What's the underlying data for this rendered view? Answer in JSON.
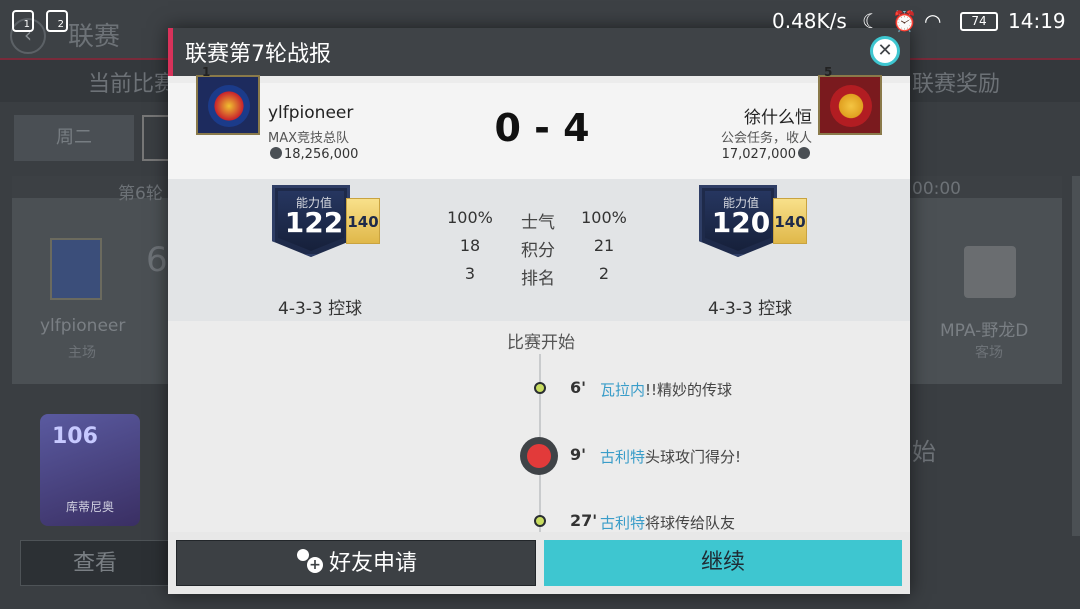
{
  "status_bar": {
    "sim1": "1",
    "sim2": "2",
    "speed": "0.48K/s",
    "battery": "74",
    "time": "14:19"
  },
  "background": {
    "title": "联赛",
    "tab_current": "当前比赛",
    "tab_rewards": "联赛奖励",
    "day": "周二",
    "round": "第6轮",
    "left_team": "ylfpioneer",
    "left_role": "主场",
    "left_score": "6",
    "right_time": "00:00",
    "right_team": "MPA-野龙D",
    "right_role": "客场",
    "player_rating": "106",
    "player_name": "库蒂尼奥",
    "mid_text": "始",
    "left_button": "查看"
  },
  "modal": {
    "title": "联赛第7轮战报",
    "home": {
      "rank": "1",
      "name": "ylfpioneer",
      "subtitle": "MAX竞技总队",
      "value": "18,256,000",
      "overall_label": "能力值",
      "overall": "122",
      "potential": "140",
      "formation": "4-3-3 控球"
    },
    "away": {
      "rank": "5",
      "name": "徐什么恒",
      "subtitle": "公会任务，收人",
      "value": "17,027,000",
      "overall_label": "能力值",
      "overall": "120",
      "potential": "140",
      "formation": "4-3-3 控球"
    },
    "score": "0 - 4",
    "stats": [
      {
        "home": "100%",
        "label": "士气",
        "away": "100%"
      },
      {
        "home": "18",
        "label": "积分",
        "away": "21"
      },
      {
        "home": "3",
        "label": "排名",
        "away": "2"
      }
    ],
    "timeline_start": "比赛开始",
    "events": [
      {
        "minute": "6'",
        "player": "瓦拉内",
        "text": "!!精妙的传球"
      },
      {
        "minute": "9'",
        "player": "古利特",
        "text": "头球攻门得分!"
      },
      {
        "minute": "27'",
        "player": "古利特",
        "text": "将球传给队友"
      }
    ],
    "buttons": {
      "friend": "好友申请",
      "continue": "继续"
    }
  }
}
